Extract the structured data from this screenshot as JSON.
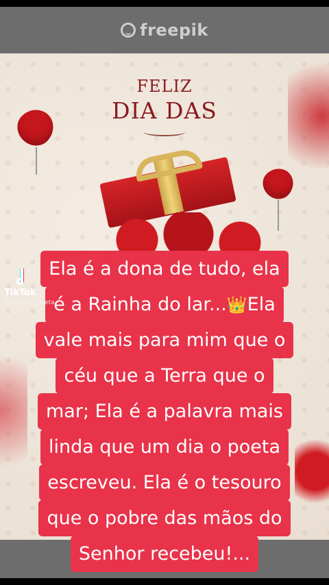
{
  "watermark": {
    "text": "freepik"
  },
  "card": {
    "heading_line1": "FELIZ",
    "heading_line2": "DIA DAS"
  },
  "overlay": {
    "app_name": "TikTok",
    "username": "@zezinho_poeta"
  },
  "caption": {
    "lines": [
      "Ela é a dona de tudo, ela",
      "é a Rainha do lar...",
      "vale mais para mim que o",
      "céu que a Terra que o",
      "mar; Ela é a palavra mais",
      "linda que um dia o poeta",
      "escreveu. Ela é o tesouro",
      "que o pobre das mãos do",
      "Senhor recebeu!..."
    ],
    "line2_emoji": "👑",
    "line2_after": "Ela"
  },
  "colors": {
    "caption_bg": "#e8334a",
    "heading": "#8a1a1e",
    "accent_red": "#c4161c",
    "gold": "#d8b55c"
  }
}
